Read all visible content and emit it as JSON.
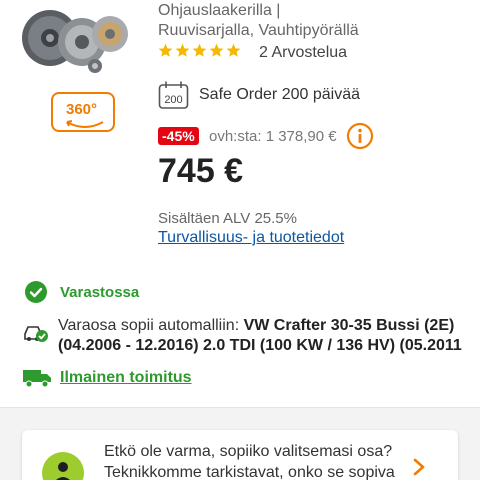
{
  "product": {
    "title_line1": "Ohjauslaakerilla |",
    "title_line2": "Ruuvisarjalla, Vauhtipyörällä",
    "rating_stars": 5,
    "rating_count": "2 Arvostelua",
    "view_360_label": "360°"
  },
  "safe_order": {
    "icon_text": "200",
    "label": "Safe Order 200 päivää"
  },
  "pricing": {
    "discount": "-45%",
    "old_price": "ovh:sta: 1 378,90 €",
    "price": "745 €",
    "vat": "Sisältäen ALV 25.5%",
    "safety_link": "Turvallisuus- ja tuotetiedot"
  },
  "availability": {
    "stock": "Varastossa",
    "fit_prefix": "Varaosa sopii automalliin: ",
    "fit_vehicle": "VW Crafter 30-35 Bussi (2E)",
    "fit_details": "(04.2006 - 12.2016) 2.0 TDI (100 KW / 136 HV) (05.2011",
    "delivery": "Ilmainen toimitus"
  },
  "check_card": {
    "text": "Etkö ole varma, sopiiko valitsemasi osa? Teknikkomme tarkistavat, onko se sopiva"
  },
  "colors": {
    "accent_orange": "#f07d00",
    "discount_red": "#e30613",
    "stock_green": "#2e9a2e",
    "link_blue": "#0b57a6",
    "star_yellow": "#f5b800"
  },
  "icons": [
    "product-image",
    "360-icon",
    "star-icon",
    "safe-order-icon",
    "info-icon",
    "check-circle-icon",
    "car-check-icon",
    "truck-icon",
    "mechanic-icon",
    "chevron-right-icon"
  ]
}
